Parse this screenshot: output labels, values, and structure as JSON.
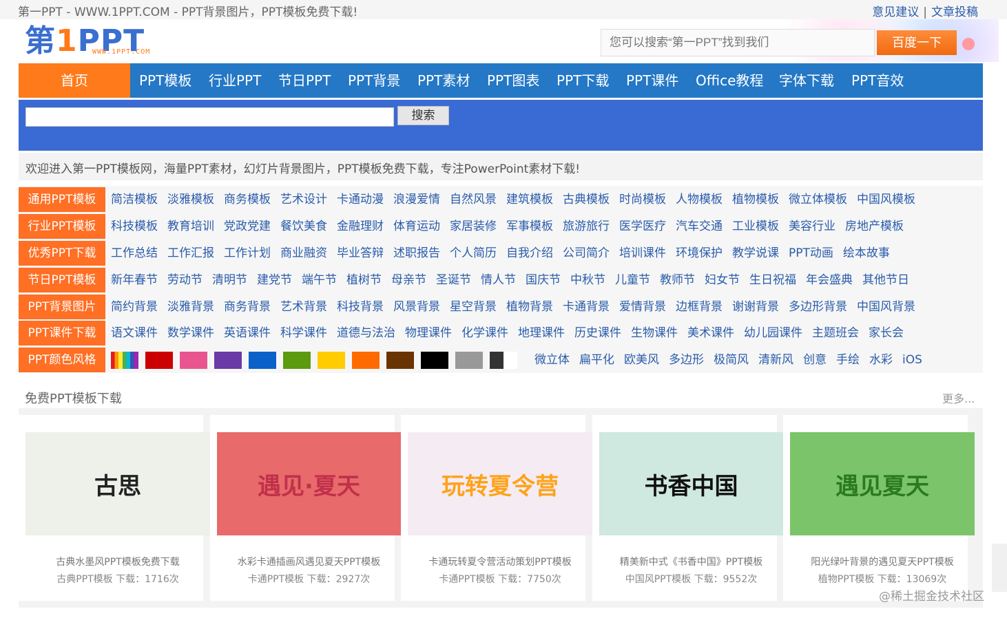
{
  "topbar": {
    "site_title": "第一PPT - WWW.1PPT.COM - PPT背景图片，PPT模板免费下载!",
    "feedback": "意见建议",
    "separator": "|",
    "submit": "文章投稿"
  },
  "logo": {
    "part1": "第",
    "part2": "1",
    "part3": "PPT",
    "sub": "WWW.1PPT.COM"
  },
  "baidu": {
    "placeholder": "您可以搜索“第一PPT”找到我们",
    "button": "百度一下"
  },
  "nav": [
    "首页",
    "PPT模板",
    "行业PPT",
    "节日PPT",
    "PPT背景",
    "PPT素材",
    "PPT图表",
    "PPT下载",
    "PPT课件",
    "Office教程",
    "字体下载",
    "PPT音效"
  ],
  "site_search": {
    "button": "搜索"
  },
  "welcome": "欢迎进入第一PPT模板网，海量PPT素材，幻灯片背景图片，PPT模板免费下载，专注PowerPoint素材下载!",
  "categories": [
    {
      "label": "通用PPT模板",
      "links": [
        "简洁模板",
        "淡雅模板",
        "商务模板",
        "艺术设计",
        "卡通动漫",
        "浪漫爱情",
        "自然风景",
        "建筑模板",
        "古典模板",
        "时尚模板",
        "人物模板",
        "植物模板",
        "微立体模板",
        "中国风模板"
      ]
    },
    {
      "label": "行业PPT模板",
      "links": [
        "科技模板",
        "教育培训",
        "党政党建",
        "餐饮美食",
        "金融理财",
        "体育运动",
        "家居装修",
        "军事模板",
        "旅游旅行",
        "医学医疗",
        "汽车交通",
        "工业模板",
        "美容行业",
        "房地产模板"
      ]
    },
    {
      "label": "优秀PPT下载",
      "links": [
        "工作总结",
        "工作汇报",
        "工作计划",
        "商业融资",
        "毕业答辩",
        "述职报告",
        "个人简历",
        "自我介绍",
        "公司简介",
        "培训课件",
        "环境保护",
        "教学说课",
        "PPT动画",
        "绘本故事"
      ]
    },
    {
      "label": "节日PPT模板",
      "links": [
        "新年春节",
        "劳动节",
        "清明节",
        "建党节",
        "端午节",
        "植树节",
        "母亲节",
        "圣诞节",
        "情人节",
        "国庆节",
        "中秋节",
        "儿童节",
        "教师节",
        "妇女节",
        "生日祝福",
        "年会盛典",
        "其他节日"
      ]
    },
    {
      "label": "PPT背景图片",
      "links": [
        "简约背景",
        "淡雅背景",
        "商务背景",
        "艺术背景",
        "科技背景",
        "风景背景",
        "星空背景",
        "植物背景",
        "卡通背景",
        "爱情背景",
        "边框背景",
        "谢谢背景",
        "多边形背景",
        "中国风背景"
      ]
    },
    {
      "label": "PPT课件下载",
      "links": [
        "语文课件",
        "数学课件",
        "英语课件",
        "科学课件",
        "道德与法治",
        "物理课件",
        "化学课件",
        "地理课件",
        "历史课件",
        "生物课件",
        "美术课件",
        "幼儿园课件",
        "主题班会",
        "家长会"
      ]
    }
  ],
  "color_row": {
    "label": "PPT颜色风格",
    "swatches": [
      "rainbow",
      "#cc0000",
      "#e8558f",
      "#6a3aa6",
      "#0a62c8",
      "#5c9a10",
      "#ffcc00",
      "#ff6a00",
      "#6a3400",
      "#000000",
      "#999999",
      "half-black"
    ],
    "styles": [
      "微立体",
      "扁平化",
      "欧美风",
      "多边形",
      "极简风",
      "清新风",
      "创意",
      "手绘",
      "水彩",
      "iOS"
    ]
  },
  "section": {
    "title": "免费PPT模板下载",
    "more": "更多..."
  },
  "cards": [
    {
      "title": "古典水墨风PPT模板免费下载",
      "meta": "古典PPT模板  下载：1716次",
      "thumb_text": "古思",
      "bg": "#eef0ea",
      "fg": "#222"
    },
    {
      "title": "水彩卡通插画风遇见夏天PPT模板",
      "meta": "卡通PPT模板  下载：2927次",
      "thumb_text": "遇见·夏天",
      "bg": "#e86a6a",
      "fg": "#c0304a"
    },
    {
      "title": "卡通玩转夏令营活动策划PPT模板",
      "meta": "卡通PPT模板  下载：7750次",
      "thumb_text": "玩转夏令营",
      "bg": "#f4ecf2",
      "fg": "#ffa21a"
    },
    {
      "title": "精美新中式《书香中国》PPT模板",
      "meta": "中国风PPT模板  下载：9552次",
      "thumb_text": "书香中国",
      "bg": "#cfe8e0",
      "fg": "#111"
    },
    {
      "title": "阳光绿叶背景的遇见夏天PPT模板",
      "meta": "植物PPT模板  下载：13069次",
      "thumb_text": "遇见夏天",
      "bg": "#7cc46a",
      "fg": "#2a7a20"
    }
  ],
  "watermark": "@稀土掘金技术社区"
}
